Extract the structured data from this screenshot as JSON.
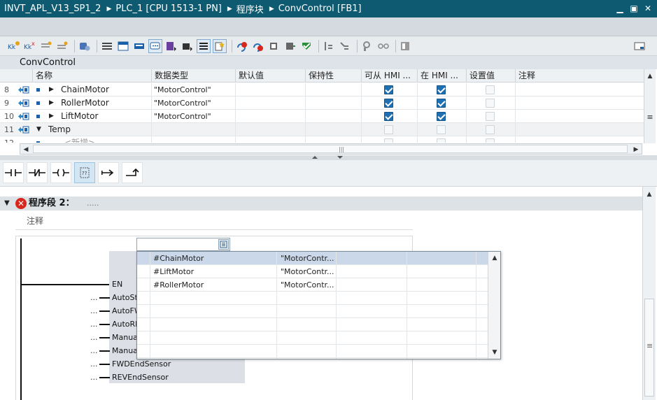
{
  "breadcrumb": [
    "INVT_APL_V13_SP1_2",
    "PLC_1 [CPU 1513-1 PN]",
    "程序块",
    "ConvControl [FB1]"
  ],
  "window_controls": [
    "minimize-icon",
    "restore-icon",
    "close-icon"
  ],
  "block_name": "ConvControl",
  "interface": {
    "columns": [
      "名称",
      "数据类型",
      "默认值",
      "保持性",
      "可从 HMI ...",
      "在 HMI ...",
      "设置值",
      "注释"
    ],
    "rows": [
      {
        "num": "8",
        "name": "ChainMotor",
        "type": "\"MotorControl\"",
        "expand": "▶",
        "hmi_access": true,
        "hmi_visible": true,
        "setpoint": false
      },
      {
        "num": "9",
        "name": "RollerMotor",
        "type": "\"MotorControl\"",
        "expand": "▶",
        "hmi_access": true,
        "hmi_visible": true,
        "setpoint": false
      },
      {
        "num": "10",
        "name": "LiftMotor",
        "type": "\"MotorControl\"",
        "expand": "▶",
        "hmi_access": true,
        "hmi_visible": true,
        "setpoint": false
      },
      {
        "num": "11",
        "name": "Temp",
        "type": "",
        "expand": "▼",
        "hmi_access": false,
        "hmi_visible": false,
        "setpoint": false
      },
      {
        "num": "12",
        "name": "<新增>",
        "type": "",
        "expand": "",
        "hmi_access": false,
        "hmi_visible": false,
        "setpoint": false
      }
    ]
  },
  "ladder_instructions": [
    "no-contact-icon",
    "nc-contact-icon",
    "coil-icon",
    "empty-box-icon",
    "open-branch-icon",
    "close-branch-icon"
  ],
  "network": {
    "title": "程序段 2：",
    "title_dots": ".....",
    "comment_label": "注释",
    "block_pins": [
      "EN",
      "AutoSt",
      "AutoFW",
      "AutoRE",
      "Manua",
      "Manua",
      "FWDEndSensor",
      "REVEndSensor"
    ],
    "pin_dots": "..."
  },
  "operand_dropdown": {
    "items": [
      {
        "name": "#ChainMotor",
        "type": "\"MotorContr...",
        "selected": true
      },
      {
        "name": "#LiftMotor",
        "type": "\"MotorContr...",
        "selected": false
      },
      {
        "name": "#RollerMotor",
        "type": "\"MotorContr...",
        "selected": false
      }
    ],
    "empty_rows": 5
  }
}
